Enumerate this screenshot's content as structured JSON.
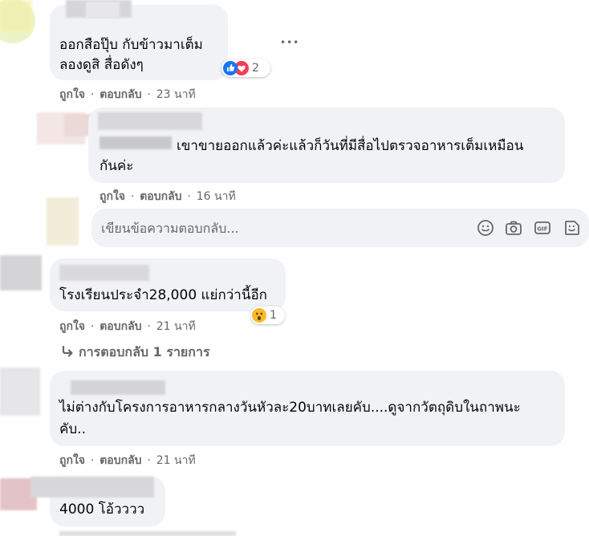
{
  "comments": [
    {
      "text_lines": [
        "ออกสือปุ๊บ กับข้าวมาเต็ม",
        "ลองดูสิ สื่อดังๆ"
      ],
      "like_label": "ถูกใจ",
      "reply_label": "ตอบกลับ",
      "time": "23 นาที",
      "reaction_count": "2"
    },
    {
      "text_lines": [
        "เขาขายออกแล้วค่ะแล้วก็วันที่มีสื่อไปตรวจอาหารเต็มเหมือน",
        "กันค่ะ"
      ],
      "like_label": "ถูกใจ",
      "reply_label": "ตอบกลับ",
      "time": "16 นาที"
    },
    {
      "text_lines": [
        "โรงเรียนประจำ28,000 แย่กว่านี้อีก"
      ],
      "like_label": "ถูกใจ",
      "reply_label": "ตอบกลับ",
      "time": "21 นาที",
      "reaction_count": "1"
    },
    {
      "text_lines": [
        "ไม่ต่างกับโครงการอาหารกลางวันหัวละ20บาทเลยคับ....ดูจากวัตถุดิบในถาพนะ",
        "คับ.."
      ],
      "like_label": "ถูกใจ",
      "reply_label": "ตอบกลับ",
      "time": "21 นาที"
    },
    {
      "text_lines": [
        "4000 โอ้วววว"
      ]
    }
  ],
  "separator": "·",
  "reply_input": {
    "placeholder": "เขียนข้อความตอบกลับ..."
  },
  "replies_link": "การตอบกลับ 1 รายการ",
  "more_options": "•••",
  "icons": [
    "like-reaction-icon",
    "love-reaction-icon",
    "wow-reaction-icon",
    "emoji-icon",
    "camera-icon",
    "gif-icon",
    "sticker-icon",
    "reply-arrow-icon",
    "more-options-icon"
  ],
  "colors": {
    "like_blue": "#1877f2",
    "love_red": "#f33e58",
    "wow_yellow": "#f7b928",
    "bubble": "#f0f2f5",
    "meta": "#65676b"
  }
}
